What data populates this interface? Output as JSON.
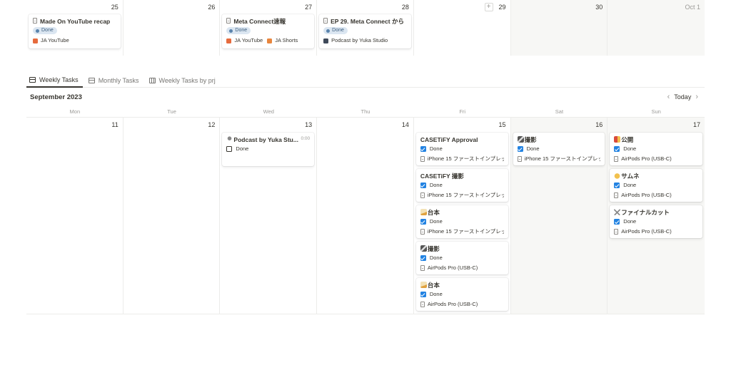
{
  "top_week": {
    "days": [
      {
        "num": "25"
      },
      {
        "num": "26"
      },
      {
        "num": "27"
      },
      {
        "num": "28"
      },
      {
        "num": "29"
      },
      {
        "num": "30"
      },
      {
        "num": "Oct 1"
      }
    ],
    "cards": [
      {
        "title": "Made On YouTube recap",
        "status": "Done",
        "tags": [
          "JA YouTube"
        ]
      },
      {
        "title": "Meta Connect速報",
        "status": "Done",
        "tags": [
          "JA YouTube",
          "JA Shorts"
        ]
      },
      {
        "title": "EP 29. Meta Connect から",
        "status": "Done",
        "tags": [
          "Podcast by Yuka Studio"
        ]
      }
    ]
  },
  "tabs": [
    {
      "label": "Weekly Tasks",
      "icon": "calendar-icon",
      "active": true
    },
    {
      "label": "Monthly Tasks",
      "icon": "calendar-icon",
      "active": false
    },
    {
      "label": "Weekly Tasks by prj",
      "icon": "board-icon",
      "active": false
    }
  ],
  "month_title": "September 2023",
  "nav": {
    "prev": "‹",
    "today": "Today",
    "next": "›"
  },
  "weekdays": [
    "Mon",
    "Tue",
    "Wed",
    "Thu",
    "Fri",
    "Sat",
    "Sun"
  ],
  "week_days": [
    "11",
    "12",
    "13",
    "14",
    "15",
    "16",
    "17"
  ],
  "wed_card": {
    "title": "Podcast by Yuka Stu...",
    "time": "0:00",
    "checkbox_label": "Done"
  },
  "fri_cards": [
    {
      "title": "CASETiFY Approval",
      "check": "Done",
      "project": "iPhone 15 ファーストインプレッ"
    },
    {
      "title": "CASETiFY 撮影",
      "check": "Done",
      "project": "iPhone 15 ファーストインプレッ"
    },
    {
      "title": "台本",
      "check": "Done",
      "project": "iPhone 15 ファーストインプレッ"
    },
    {
      "title": "撮影",
      "check": "Done",
      "project": "AirPods Pro (USB-C)"
    },
    {
      "title": "台本",
      "check": "Done",
      "project": "AirPods Pro (USB-C)"
    }
  ],
  "sat_card": {
    "title": "撮影",
    "check": "Done",
    "project": "iPhone 15 ファーストインプレッ..."
  },
  "sun_cards": [
    {
      "title": "公開",
      "check": "Done",
      "project": "AirPods Pro (USB-C)"
    },
    {
      "title": "サムネ",
      "check": "Done",
      "project": "AirPods Pro (USB-C)"
    },
    {
      "title": "ファイナルカット",
      "check": "Done",
      "project": "AirPods Pro (USB-C)"
    }
  ],
  "colors": {
    "checkbox": "#2383e2",
    "badge_bg": "#dbe6f1",
    "weekend_bg": "#f7f7f5"
  }
}
